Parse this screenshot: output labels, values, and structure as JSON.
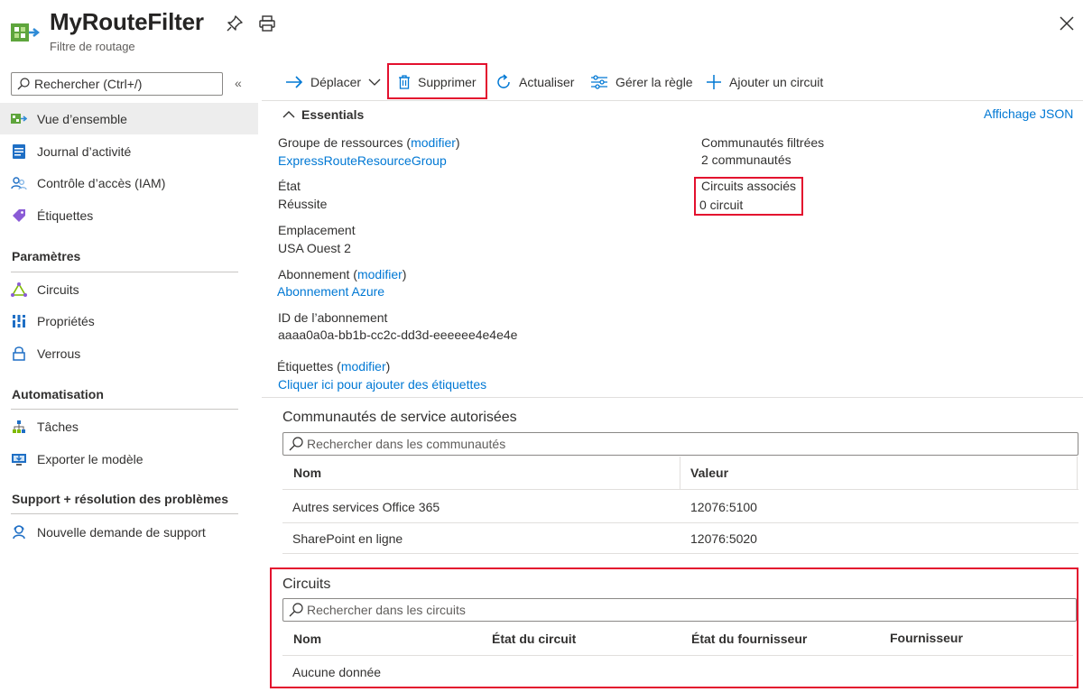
{
  "header": {
    "title": "MyRouteFilter",
    "subtitle": "Filtre de routage"
  },
  "sidebar": {
    "search_placeholder": "Rechercher (Ctrl+/)",
    "collapse_label": "«",
    "items": [
      {
        "label": "Vue d’ensemble",
        "icon": "route-filter-icon"
      },
      {
        "label": "Journal d’activité",
        "icon": "activity-log-icon"
      },
      {
        "label": "Contrôle d’accès (IAM)",
        "icon": "people-icon"
      },
      {
        "label": "Étiquettes",
        "icon": "tag-icon"
      }
    ],
    "sections": [
      {
        "title": "Paramètres",
        "items": [
          {
            "label": "Circuits",
            "icon": "circuits-icon"
          },
          {
            "label": "Propriétés",
            "icon": "properties-icon"
          },
          {
            "label": "Verrous",
            "icon": "lock-icon"
          }
        ]
      },
      {
        "title": "Automatisation",
        "items": [
          {
            "label": "Tâches",
            "icon": "tasks-icon"
          },
          {
            "label": "Exporter le modèle",
            "icon": "export-template-icon"
          }
        ]
      },
      {
        "title": "Support + résolution des problèmes",
        "items": [
          {
            "label": "Nouvelle demande de support",
            "icon": "support-icon"
          }
        ]
      }
    ]
  },
  "toolbar": {
    "move_label": "Déplacer",
    "delete_label": "Supprimer",
    "refresh_label": "Actualiser",
    "manage_rule_label": "Gérer la règle",
    "add_circuit_label": "Ajouter un circuit"
  },
  "essentials": {
    "toggle_label": "Essentials",
    "json_view_label": "Affichage JSON",
    "resource_group_label": "Groupe de ressources",
    "modify_label": "modifier",
    "resource_group_value": "ExpressRouteResourceGroup",
    "state_label": "État",
    "state_value": "Réussite",
    "location_label": "Emplacement",
    "location_value": "USA Ouest 2",
    "subscription_label": "Abonnement",
    "subscription_value": "Abonnement Azure",
    "subscription_id_label": "ID de l’abonnement",
    "subscription_id_value": "aaaa0a0a-bb1b-cc2c-dd3d-eeeeee4e4e4e",
    "tags_label": "Étiquettes",
    "tags_value": "Cliquer ici pour ajouter des étiquettes",
    "filtered_communities_label": "Communautés filtrées",
    "filtered_communities_value": "2 communautés",
    "associated_circuits_label": "Circuits associés",
    "associated_circuits_value": "0 circuit"
  },
  "communities": {
    "title": "Communautés de service autorisées",
    "search_placeholder": "Rechercher dans les communautés",
    "columns": [
      "Nom",
      "Valeur"
    ],
    "rows": [
      [
        "Autres services Office 365",
        "12076:5100"
      ],
      [
        "SharePoint en ligne",
        "12076:5020"
      ]
    ]
  },
  "circuits": {
    "title": "Circuits",
    "search_placeholder": "Rechercher dans les circuits",
    "columns": [
      "Nom",
      "État du circuit",
      "État du fournisseur",
      "Fournisseur"
    ],
    "empty_text": "Aucune donnée"
  },
  "colors": {
    "accent": "#0078d4",
    "highlight": "#e3102e"
  }
}
